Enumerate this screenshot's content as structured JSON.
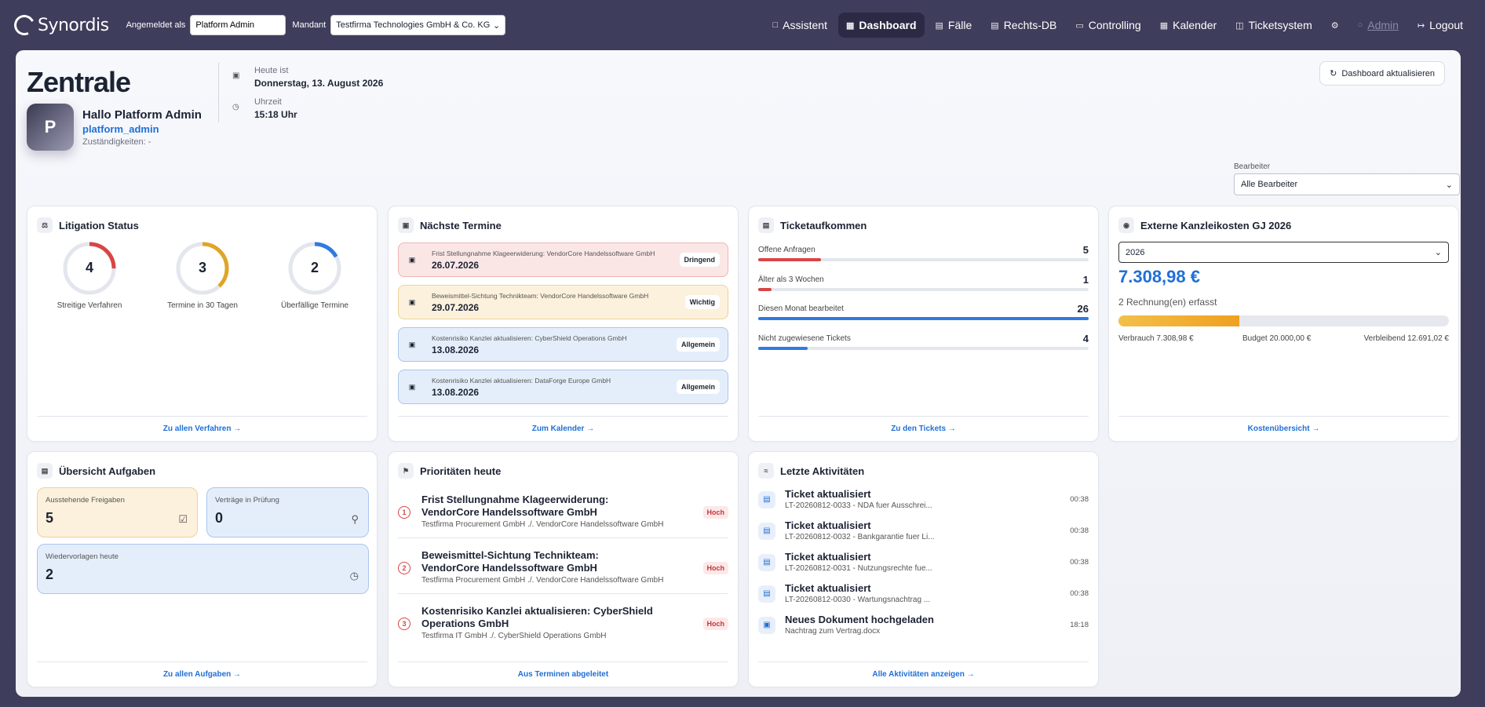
{
  "topbar": {
    "brand": "Synordis",
    "logged_in_label": "Angemeldet als",
    "logged_in_value": "Platform Admin",
    "tenant_label": "Mandant",
    "tenant_value": "Testfirma Technologies GmbH & Co. KG",
    "nav": [
      {
        "label": "Assistent",
        "icon": "chat-icon"
      },
      {
        "label": "Dashboard",
        "icon": "grid-icon",
        "active": true
      },
      {
        "label": "Fälle",
        "icon": "briefcase-icon"
      },
      {
        "label": "Rechts-DB",
        "icon": "database-icon"
      },
      {
        "label": "Controlling",
        "icon": "document-icon"
      },
      {
        "label": "Kalender",
        "icon": "calendar-icon"
      },
      {
        "label": "Ticketsystem",
        "icon": "ticket-icon"
      }
    ],
    "admin_label": "Admin",
    "logout_label": "Logout"
  },
  "header": {
    "title": "Zentrale",
    "avatar_letter": "P",
    "greeting": "Hallo Platform Admin",
    "username": "platform_admin",
    "responsibilities": "Zuständigkeiten: -",
    "today_label": "Heute ist",
    "today_value": "Donnerstag, 13. August 2026",
    "time_label": "Uhrzeit",
    "time_value": "15:18 Uhr",
    "refresh_label": "Dashboard aktualisieren",
    "editor_label": "Bearbeiter",
    "editor_value": "Alle Bearbeiter"
  },
  "litigation": {
    "title": "Litigation Status",
    "gauges": [
      {
        "value": "4",
        "label": "Streitige Verfahren",
        "color": "#d94545",
        "fraction": 0.25
      },
      {
        "value": "3",
        "label": "Termine in 30 Tagen",
        "color": "#e0a526",
        "fraction": 0.38
      },
      {
        "value": "2",
        "label": "Überfällige Termine",
        "color": "#2f7be0",
        "fraction": 0.17
      }
    ],
    "footer": "Zu allen Verfahren →"
  },
  "termine": {
    "title": "Nächste Termine",
    "items": [
      {
        "text": "Frist Stellungnahme Klageerwiderung: VendorCore Handelssoftware GmbH",
        "date": "26.07.2026",
        "badge": "Dringend",
        "kind": "red"
      },
      {
        "text": "Beweismittel-Sichtung Technikteam: VendorCore Handelssoftware GmbH",
        "date": "29.07.2026",
        "badge": "Wichtig",
        "kind": "yellow"
      },
      {
        "text": "Kostenrisiko Kanzlei aktualisieren: CyberShield Operations GmbH",
        "date": "13.08.2026",
        "badge": "Allgemein",
        "kind": "blue"
      },
      {
        "text": "Kostenrisiko Kanzlei aktualisieren: DataForge Europe GmbH",
        "date": "13.08.2026",
        "badge": "Allgemein",
        "kind": "blue"
      }
    ],
    "footer": "Zum Kalender →"
  },
  "tickets": {
    "title": "Ticketaufkommen",
    "rows": [
      {
        "label": "Offene Anfragen",
        "value": "5",
        "fraction": 0.19,
        "color": "#d94545"
      },
      {
        "label": "Älter als 3 Wochen",
        "value": "1",
        "fraction": 0.04,
        "color": "#d94545"
      },
      {
        "label": "Diesen Monat bearbeitet",
        "value": "26",
        "fraction": 1.0,
        "color": "#2f7be0"
      },
      {
        "label": "Nicht zugewiesene Tickets",
        "value": "4",
        "fraction": 0.15,
        "color": "#2f7be0"
      }
    ],
    "footer": "Zu den Tickets →"
  },
  "kosten": {
    "title": "Externe Kanzleikosten GJ 2026",
    "year": "2026",
    "amount": "7.308,98 €",
    "count": "2 Rechnung(en) erfasst",
    "fraction": 0.365,
    "used": "Verbrauch 7.308,98 €",
    "budget": "Budget 20.000,00 €",
    "remaining": "Verbleibend 12.691,02 €",
    "footer": "Kostenübersicht →"
  },
  "aufgaben": {
    "title": "Übersicht Aufgaben",
    "tiles": [
      {
        "label": "Ausstehende Freigaben",
        "value": "5"
      },
      {
        "label": "Verträge in Prüfung",
        "value": "0"
      },
      {
        "label": "Wiedervorlagen heute",
        "value": "2"
      }
    ],
    "footer": "Zu allen Aufgaben →"
  },
  "prioritaeten": {
    "title": "Prioritäten heute",
    "items": [
      {
        "num": "1",
        "title": "Frist Stellungnahme Klageerwiderung: VendorCore Handelssoftware GmbH",
        "sub": "Testfirma Procurement GmbH ./. VendorCore Handelssoftware GmbH",
        "badge": "Hoch"
      },
      {
        "num": "2",
        "title": "Beweismittel-Sichtung Technikteam: VendorCore Handelssoftware GmbH",
        "sub": "Testfirma Procurement GmbH ./. VendorCore Handelssoftware GmbH",
        "badge": "Hoch"
      },
      {
        "num": "3",
        "title": "Kostenrisiko Kanzlei aktualisieren: CyberShield Operations GmbH",
        "sub": "Testfirma IT GmbH ./. CyberShield Operations GmbH",
        "badge": "Hoch"
      }
    ],
    "footer": "Aus Terminen abgeleitet"
  },
  "aktivitaeten": {
    "title": "Letzte Aktivitäten",
    "items": [
      {
        "title": "Ticket aktualisiert",
        "sub": "LT-20260812-0033 - NDA fuer Ausschrei...",
        "time": "00:38"
      },
      {
        "title": "Ticket aktualisiert",
        "sub": "LT-20260812-0032 - Bankgarantie fuer Li...",
        "time": "00:38"
      },
      {
        "title": "Ticket aktualisiert",
        "sub": "LT-20260812-0031 - Nutzungsrechte fue...",
        "time": "00:38"
      },
      {
        "title": "Ticket aktualisiert",
        "sub": "LT-20260812-0030 - Wartungsnachtrag ...",
        "time": "00:38"
      },
      {
        "title": "Neues Dokument hochgeladen",
        "sub": "Nachtrag zum Vertrag.docx",
        "time": "18:18"
      }
    ],
    "footer": "Alle Aktivitäten anzeigen →"
  }
}
